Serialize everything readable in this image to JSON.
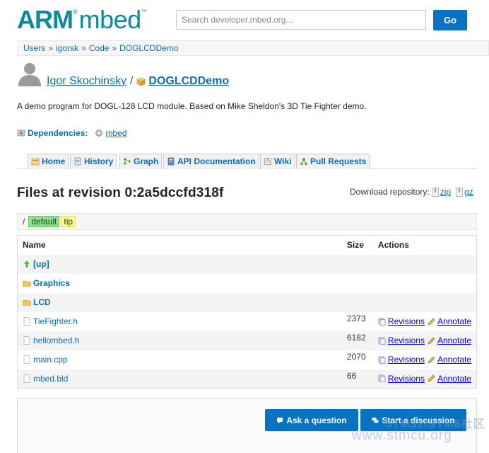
{
  "header": {
    "logo_arm": "ARM",
    "logo_reg": "®",
    "logo_mbed": "mbed",
    "logo_tm": "™",
    "search_placeholder": "Search developer.mbed.org...",
    "go_label": "Go"
  },
  "breadcrumb": {
    "items": [
      "Users",
      "igorsk",
      "Code",
      "DOGLCDDemo"
    ],
    "separator": "»"
  },
  "title": {
    "user": "Igor Skochinsky",
    "slash": "/",
    "repo": "DOGLCDDemo"
  },
  "description": "A demo program for DOGL-128 LCD module. Based on Mike Sheldon's 3D Tie Fighter demo.",
  "dependencies": {
    "label": "Dependencies:",
    "items": [
      "mbed"
    ]
  },
  "tabs": [
    {
      "label": "Home",
      "icon": "home-icon"
    },
    {
      "label": "History",
      "icon": "history-icon"
    },
    {
      "label": "Graph",
      "icon": "graph-icon"
    },
    {
      "label": "API Documentation",
      "icon": "api-docs-icon"
    },
    {
      "label": "Wiki",
      "icon": "wiki-icon"
    },
    {
      "label": "Pull Requests",
      "icon": "pull-request-icon"
    }
  ],
  "files": {
    "title": "Files at revision 0:2a5dccfd318f",
    "download_label": "Download repository:",
    "download_zip": "zip",
    "download_gz": "gz",
    "branch_slash": "/",
    "branch_default": "default",
    "branch_tip": "tip",
    "columns": {
      "name": "Name",
      "size": "Size",
      "actions": "Actions"
    },
    "rows": [
      {
        "name": "[up]",
        "type": "up",
        "size": "",
        "revisions": "",
        "annotate": ""
      },
      {
        "name": "Graphics",
        "type": "dir",
        "size": "",
        "revisions": "",
        "annotate": ""
      },
      {
        "name": "LCD",
        "type": "dir",
        "size": "",
        "revisions": "",
        "annotate": ""
      },
      {
        "name": "TieFighter.h",
        "type": "file",
        "size": "2373",
        "revisions": "Revisions",
        "annotate": "Annotate"
      },
      {
        "name": "hellombed.h",
        "type": "file",
        "size": "6182",
        "revisions": "Revisions",
        "annotate": "Annotate"
      },
      {
        "name": "main.cpp",
        "type": "file",
        "size": "2070",
        "revisions": "Revisions",
        "annotate": "Annotate"
      },
      {
        "name": "mbed.bld",
        "type": "file",
        "size": "66",
        "revisions": "Revisions",
        "annotate": "Annotate"
      }
    ]
  },
  "buttons": {
    "ask": "Ask a question",
    "discuss": "Start a discussion"
  },
  "watermark": {
    "line1": "STM32/STM8社区",
    "line2": "www.stmcu.org"
  },
  "colors": {
    "brand": "#0a8ba0",
    "link": "#0b6cbd",
    "button": "#0873c4",
    "badge_default": "#8fe08f",
    "badge_tip": "#ffff88"
  }
}
